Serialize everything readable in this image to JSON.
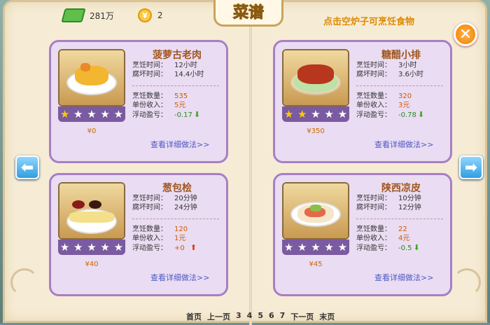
{
  "header": {
    "money_value": "281万",
    "coin_symbol": "¥",
    "coin_value": "2",
    "title": "菜谱",
    "hint": "点击空炉子可烹饪食物",
    "close_symbol": "✕"
  },
  "nav": {
    "prev_symbol": "⬅",
    "next_symbol": "➡"
  },
  "labels": {
    "cook_time": "烹饪时间：",
    "spoil_time": "腐坏时间：",
    "cook_count": "烹饪数量：",
    "unit_income": "单份收入：",
    "float_pl": "浮动盈亏：",
    "detail_link": "查看详细做法>>"
  },
  "recipes": [
    {
      "name": "菠萝古老肉",
      "cook_time": "12小时",
      "spoil_time": "14.4小时",
      "count": "535",
      "income": "5元",
      "pl": "-0.17",
      "trend": "down",
      "trend_symbol": "⬇",
      "stars_filled": 1,
      "price": "¥0"
    },
    {
      "name": "糖醋小排",
      "cook_time": "3小时",
      "spoil_time": "3.6小时",
      "count": "320",
      "income": "3元",
      "pl": "-0.78",
      "trend": "down",
      "trend_symbol": "⬇",
      "stars_filled": 2,
      "price": "¥350"
    },
    {
      "name": "葱包桧",
      "cook_time": "20分钟",
      "spoil_time": "24分钟",
      "count": "120",
      "income": "1元",
      "pl": "+0",
      "trend": "up",
      "trend_symbol": "⬆",
      "stars_filled": 0,
      "price": "¥40"
    },
    {
      "name": "陕西凉皮",
      "cook_time": "10分钟",
      "spoil_time": "12分钟",
      "count": "22",
      "income": "4元",
      "pl": "-0.5",
      "trend": "down",
      "trend_symbol": "⬇",
      "stars_filled": 0,
      "price": "¥45"
    }
  ],
  "pager": {
    "first": "首页",
    "prev": "上一页",
    "pages": [
      "3",
      "4",
      "5",
      "6",
      "7"
    ],
    "next": "下一页",
    "last": "末页"
  }
}
